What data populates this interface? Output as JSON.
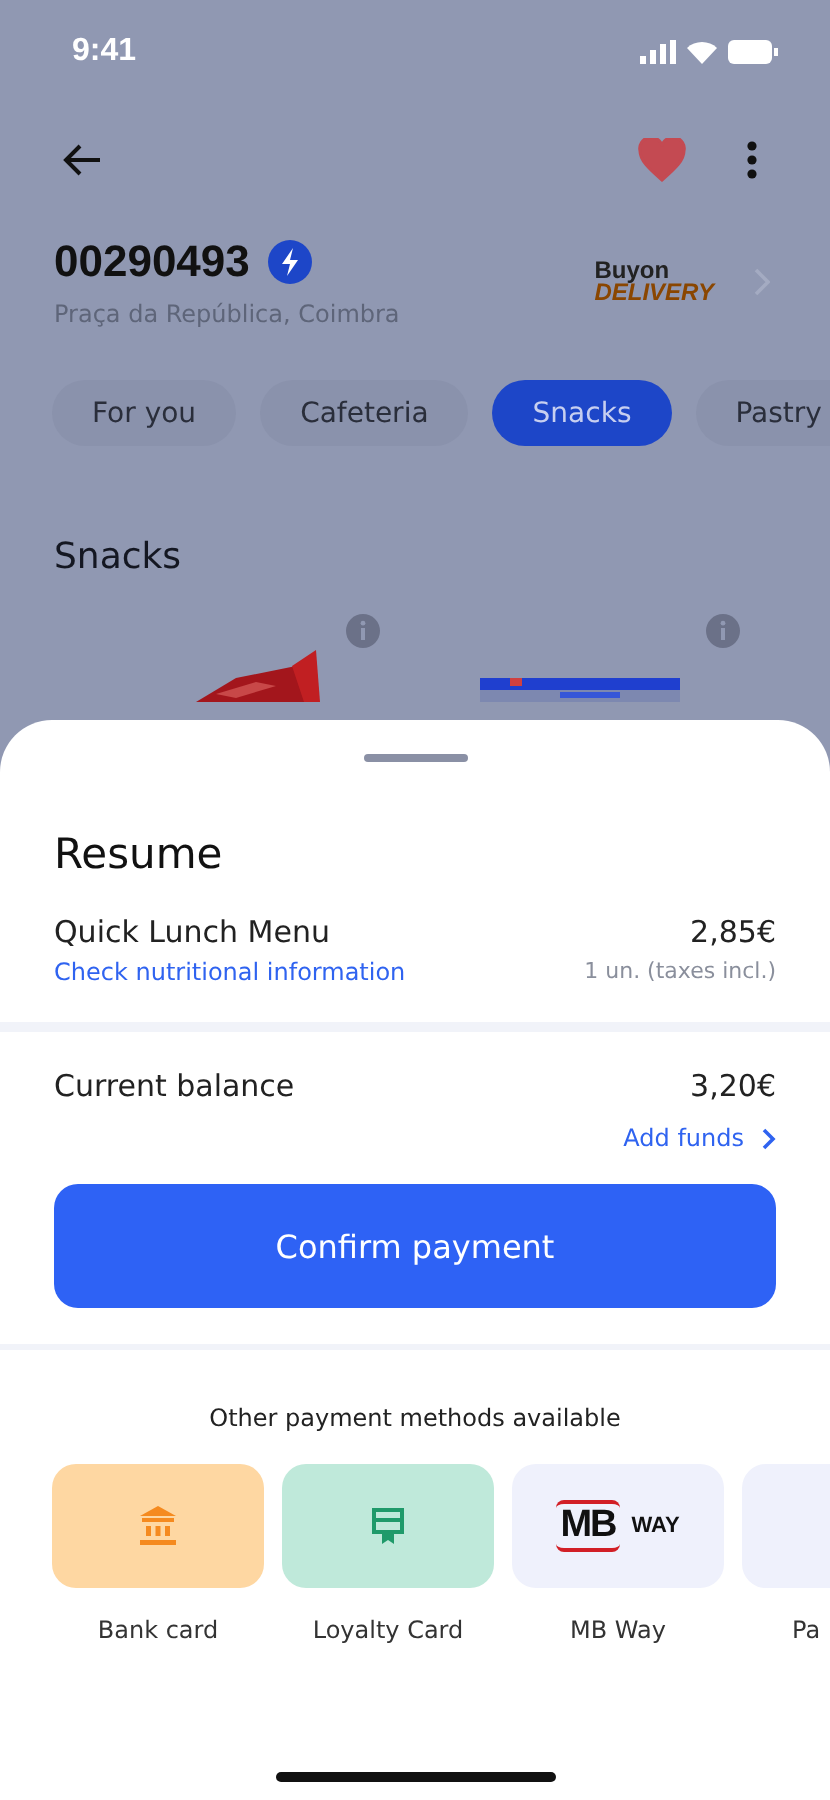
{
  "status_bar": {
    "time": "9:41"
  },
  "header": {
    "store_id": "00290493",
    "address": "Praça da República, Coimbra",
    "favorite": true,
    "logo": {
      "line_1": "Buyon",
      "line_2": "DELIVERY"
    }
  },
  "tabs": [
    {
      "label": "For you",
      "selected": false
    },
    {
      "label": "Cafeteria",
      "selected": false
    },
    {
      "label": "Snacks",
      "selected": true
    },
    {
      "label": "Pastry",
      "selected": false
    }
  ],
  "section_title": "Snacks",
  "sheet": {
    "title": "Resume",
    "item": {
      "name": "Quick Lunch Menu",
      "link": "Check nutritional information",
      "price": "2,85€",
      "note": "1 un. (taxes incl.)"
    },
    "balance": {
      "label": "Current balance",
      "amount": "3,20€",
      "link": "Add funds"
    },
    "confirm_button": "Confirm payment",
    "other_title": "Other payment methods available",
    "methods": [
      {
        "kind": "bank",
        "label": "Bank card"
      },
      {
        "kind": "loyalty",
        "label": "Loyalty Card"
      },
      {
        "kind": "mbway",
        "label": "MB Way",
        "logo_1": "MB",
        "logo_2": "WAY"
      },
      {
        "kind": "blank",
        "label": "Pa"
      }
    ]
  }
}
